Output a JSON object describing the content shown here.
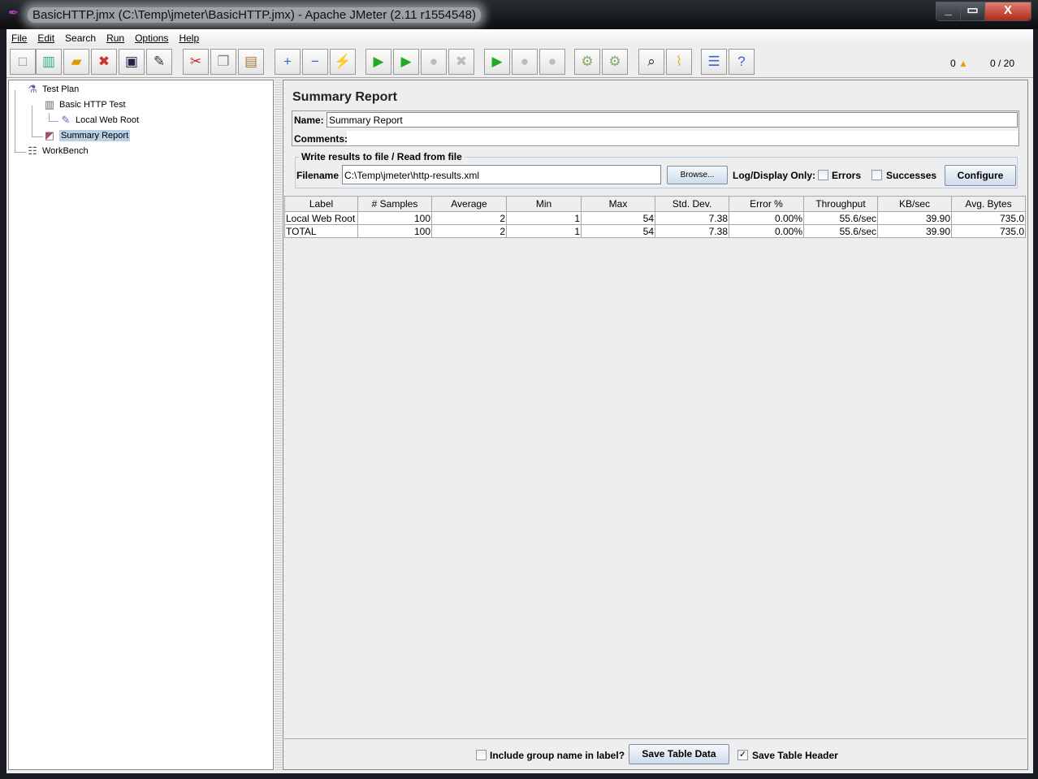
{
  "window": {
    "title": "BasicHTTP.jmx (C:\\Temp\\jmeter\\BasicHTTP.jmx) - Apache JMeter (2.11 r1554548)"
  },
  "menu": [
    "File",
    "Edit",
    "Search",
    "Run",
    "Options",
    "Help"
  ],
  "toolbar": {
    "buttons": [
      {
        "name": "new",
        "glyph": "□"
      },
      {
        "name": "templates",
        "glyph": "▥"
      },
      {
        "name": "open",
        "glyph": "▰"
      },
      {
        "name": "close",
        "glyph": "✖"
      },
      {
        "name": "save",
        "glyph": "▣"
      },
      {
        "name": "save-as",
        "glyph": "✎"
      },
      {
        "name": "cut",
        "glyph": "✂"
      },
      {
        "name": "copy",
        "glyph": "❐"
      },
      {
        "name": "paste",
        "glyph": "▤"
      },
      {
        "name": "expand",
        "glyph": "+"
      },
      {
        "name": "collapse",
        "glyph": "−"
      },
      {
        "name": "toggle",
        "glyph": "⚡"
      },
      {
        "name": "start",
        "glyph": "▶"
      },
      {
        "name": "start-no-pause",
        "glyph": "▶"
      },
      {
        "name": "stop",
        "glyph": "●"
      },
      {
        "name": "shutdown",
        "glyph": "✖"
      },
      {
        "name": "remote-start",
        "glyph": "▶"
      },
      {
        "name": "remote-stop",
        "glyph": "●"
      },
      {
        "name": "remote-shutdown",
        "glyph": "●"
      },
      {
        "name": "clear",
        "glyph": "⚙"
      },
      {
        "name": "clear-all",
        "glyph": "⚙"
      },
      {
        "name": "search",
        "glyph": "⌕"
      },
      {
        "name": "reset-search",
        "glyph": "⌇"
      },
      {
        "name": "function-helper",
        "glyph": "☰"
      },
      {
        "name": "help",
        "glyph": "?"
      }
    ],
    "warnings": "0",
    "threads": "0 / 20"
  },
  "tree": [
    {
      "label": "Test Plan",
      "icon": "flask-icon"
    },
    {
      "label": "Basic HTTP Test",
      "icon": "spool-icon"
    },
    {
      "label": "Local Web Root",
      "icon": "pipette-icon"
    },
    {
      "label": "Summary Report",
      "icon": "gauge-icon"
    },
    {
      "label": "WorkBench",
      "icon": "clipboard-icon"
    }
  ],
  "panel": {
    "title": "Summary Report",
    "name_label": "Name:",
    "name_value": "Summary Report",
    "comments_label": "Comments:",
    "comments_value": "",
    "file_legend": "Write results to file / Read from file",
    "filename_label": "Filename",
    "filename_value": "C:\\Temp\\jmeter\\http-results.xml",
    "browse": "Browse...",
    "log_only": "Log/Display Only:",
    "errors": "Errors",
    "successes": "Successes",
    "configure": "Configure"
  },
  "table": {
    "headers": [
      "Label",
      "# Samples",
      "Average",
      "Min",
      "Max",
      "Std. Dev.",
      "Error %",
      "Throughput",
      "KB/sec",
      "Avg. Bytes"
    ],
    "rows": [
      [
        "Local Web Root",
        "100",
        "2",
        "1",
        "54",
        "7.38",
        "0.00%",
        "55.6/sec",
        "39.90",
        "735.0"
      ],
      [
        "TOTAL",
        "100",
        "2",
        "1",
        "54",
        "7.38",
        "0.00%",
        "55.6/sec",
        "39.90",
        "735.0"
      ]
    ]
  },
  "footer": {
    "include_group": "Include group name in label?",
    "include_group_checked": false,
    "save_table_data": "Save Table Data",
    "save_header": "Save Table Header",
    "save_header_checked": true
  }
}
